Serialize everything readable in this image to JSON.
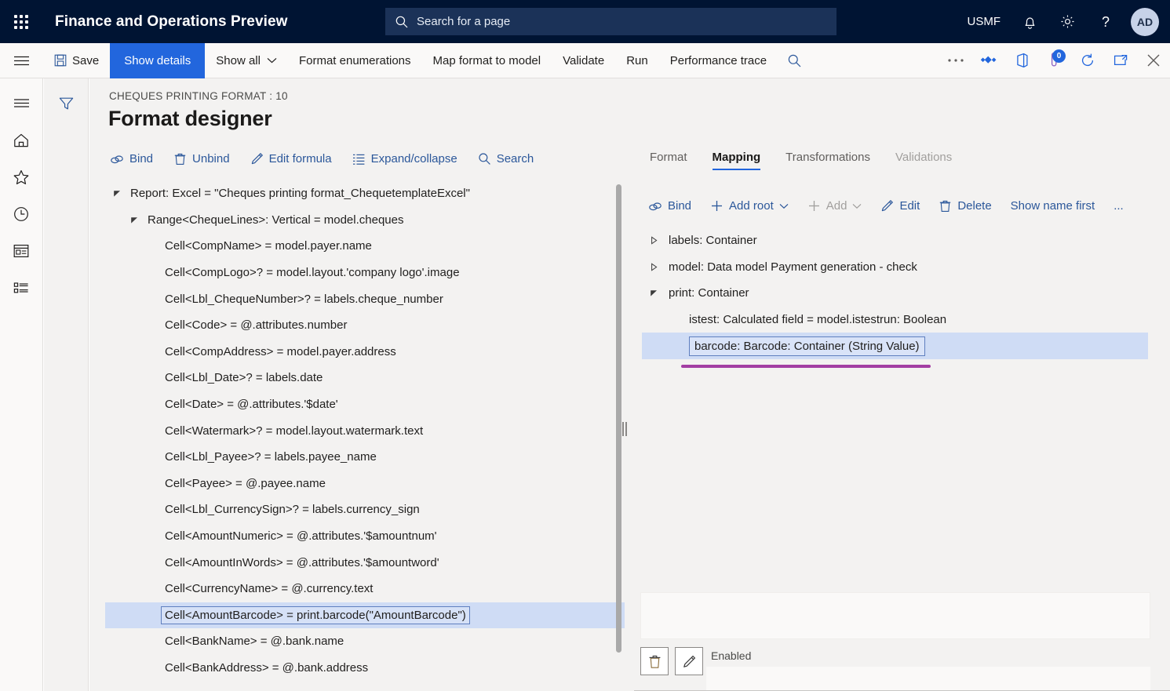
{
  "topbar": {
    "waffle_icon": "app-launcher-icon",
    "app_title": "Finance and Operations Preview",
    "search": {
      "placeholder": "Search for a page",
      "icon": "search-icon"
    },
    "company": "USMF",
    "notifications_icon": "bell-icon",
    "settings_icon": "gear-icon",
    "help_icon": "question-mark-icon",
    "avatar_initials": "AD"
  },
  "actionbar": {
    "hamburger_icon": "hamburger-menu-icon",
    "save_label": "Save",
    "save_icon": "save-disk-icon",
    "show_details_label": "Show details",
    "show_all_label": "Show all",
    "format_enumerations_label": "Format enumerations",
    "map_format_to_model_label": "Map format to model",
    "validate_label": "Validate",
    "run_label": "Run",
    "performance_trace_label": "Performance trace",
    "search_icon": "search-icon",
    "overflow_label": "...",
    "attachments_icon": "attachments-icon",
    "office_icon": "open-in-office-icon",
    "notes_icon": "notes-icon",
    "notes_badge": "0",
    "refresh_icon": "refresh-icon",
    "popout_icon": "open-in-new-window-icon",
    "close_icon": "close-icon"
  },
  "navrail": {
    "items": [
      {
        "icon": "hamburger-menu-icon",
        "name": "menu"
      },
      {
        "icon": "home-icon",
        "name": "home"
      },
      {
        "icon": "star-icon",
        "name": "favorites"
      },
      {
        "icon": "clock-icon",
        "name": "recent"
      },
      {
        "icon": "workspaces-icon",
        "name": "workspaces"
      },
      {
        "icon": "modules-icon",
        "name": "modules"
      }
    ]
  },
  "filterrail": {
    "filter_icon": "filter-icon"
  },
  "page": {
    "breadcrumb": "CHEQUES PRINTING FORMAT : 10",
    "title": "Format designer"
  },
  "left_commands": [
    {
      "label": "Bind",
      "icon": "bind-link-icon",
      "disabled": false
    },
    {
      "label": "Unbind",
      "icon": "trash-icon",
      "disabled": false
    },
    {
      "label": "Edit formula",
      "icon": "pencil-icon",
      "disabled": false
    },
    {
      "label": "Expand/collapse",
      "icon": "list-icon",
      "disabled": false
    },
    {
      "label": "Search",
      "icon": "search-icon",
      "disabled": false
    }
  ],
  "format_tree": [
    {
      "label": "Report: Excel = \"Cheques printing format_ChequetemplateExcel\"",
      "indent": 0,
      "twisty": "expanded",
      "selected": false
    },
    {
      "label": "Range<ChequeLines>: Vertical = model.cheques",
      "indent": 1,
      "twisty": "expanded",
      "selected": false
    },
    {
      "label": "Cell<CompName> = model.payer.name",
      "indent": 2,
      "twisty": "none",
      "selected": false
    },
    {
      "label": "Cell<CompLogo>? = model.layout.'company logo'.image",
      "indent": 2,
      "twisty": "none",
      "selected": false
    },
    {
      "label": "Cell<Lbl_ChequeNumber>? = labels.cheque_number",
      "indent": 2,
      "twisty": "none",
      "selected": false
    },
    {
      "label": "Cell<Code> = @.attributes.number",
      "indent": 2,
      "twisty": "none",
      "selected": false
    },
    {
      "label": "Cell<CompAddress> = model.payer.address",
      "indent": 2,
      "twisty": "none",
      "selected": false
    },
    {
      "label": "Cell<Lbl_Date>? = labels.date",
      "indent": 2,
      "twisty": "none",
      "selected": false
    },
    {
      "label": "Cell<Date> = @.attributes.'$date'",
      "indent": 2,
      "twisty": "none",
      "selected": false
    },
    {
      "label": "Cell<Watermark>? = model.layout.watermark.text",
      "indent": 2,
      "twisty": "none",
      "selected": false
    },
    {
      "label": "Cell<Lbl_Payee>? = labels.payee_name",
      "indent": 2,
      "twisty": "none",
      "selected": false
    },
    {
      "label": "Cell<Payee> = @.payee.name",
      "indent": 2,
      "twisty": "none",
      "selected": false
    },
    {
      "label": "Cell<Lbl_CurrencySign>? = labels.currency_sign",
      "indent": 2,
      "twisty": "none",
      "selected": false
    },
    {
      "label": "Cell<AmountNumeric> = @.attributes.'$amountnum'",
      "indent": 2,
      "twisty": "none",
      "selected": false
    },
    {
      "label": "Cell<AmountInWords> = @.attributes.'$amountword'",
      "indent": 2,
      "twisty": "none",
      "selected": false
    },
    {
      "label": "Cell<CurrencyName> = @.currency.text",
      "indent": 2,
      "twisty": "none",
      "selected": false
    },
    {
      "label": "Cell<AmountBarcode> = print.barcode(\"AmountBarcode\")",
      "indent": 2,
      "twisty": "none",
      "selected": true
    },
    {
      "label": "Cell<BankName> = @.bank.name",
      "indent": 2,
      "twisty": "none",
      "selected": false
    },
    {
      "label": "Cell<BankAddress> = @.bank.address",
      "indent": 2,
      "twisty": "none",
      "selected": false
    }
  ],
  "right_tabs": [
    {
      "label": "Format",
      "active": false,
      "disabled": false
    },
    {
      "label": "Mapping",
      "active": true,
      "disabled": false
    },
    {
      "label": "Transformations",
      "active": false,
      "disabled": false
    },
    {
      "label": "Validations",
      "active": false,
      "disabled": true
    }
  ],
  "right_commands": [
    {
      "label": "Bind",
      "icon": "bind-link-icon",
      "disabled": false,
      "caret": false
    },
    {
      "label": "Add root",
      "icon": "plus-icon",
      "disabled": false,
      "caret": true
    },
    {
      "label": "Add",
      "icon": "plus-icon",
      "disabled": true,
      "caret": true
    },
    {
      "label": "Edit",
      "icon": "pencil-icon",
      "disabled": false,
      "caret": false
    },
    {
      "label": "Delete",
      "icon": "trash-icon",
      "disabled": false,
      "caret": false
    },
    {
      "label": "Show name first",
      "icon": "none",
      "disabled": false,
      "caret": false
    },
    {
      "label": "...",
      "icon": "none",
      "disabled": false,
      "caret": false
    }
  ],
  "mapping_tree": [
    {
      "label": "labels: Container",
      "indent": 0,
      "twisty": "collapsed",
      "selected": false
    },
    {
      "label": "model: Data model Payment generation - check",
      "indent": 0,
      "twisty": "collapsed",
      "selected": false
    },
    {
      "label": "print: Container",
      "indent": 0,
      "twisty": "expanded",
      "selected": false
    },
    {
      "label": "istest: Calculated field = model.istestrun: Boolean",
      "indent": 1,
      "twisty": "none",
      "selected": false
    },
    {
      "label": "barcode: Barcode: Container (String Value)",
      "indent": 1,
      "twisty": "none",
      "selected": true
    }
  ],
  "detail": {
    "delete_icon": "trash-icon",
    "edit_icon": "pencil-icon",
    "enabled_label": "Enabled",
    "enabled_value": ""
  },
  "colors": {
    "brand_navy": "#001433",
    "accent_blue": "#2266dd",
    "link_blue": "#2b579a",
    "selection_blue": "#cfdcf5",
    "highlight_purple": "#a33ea3",
    "page_bg": "#f3f2f1"
  }
}
